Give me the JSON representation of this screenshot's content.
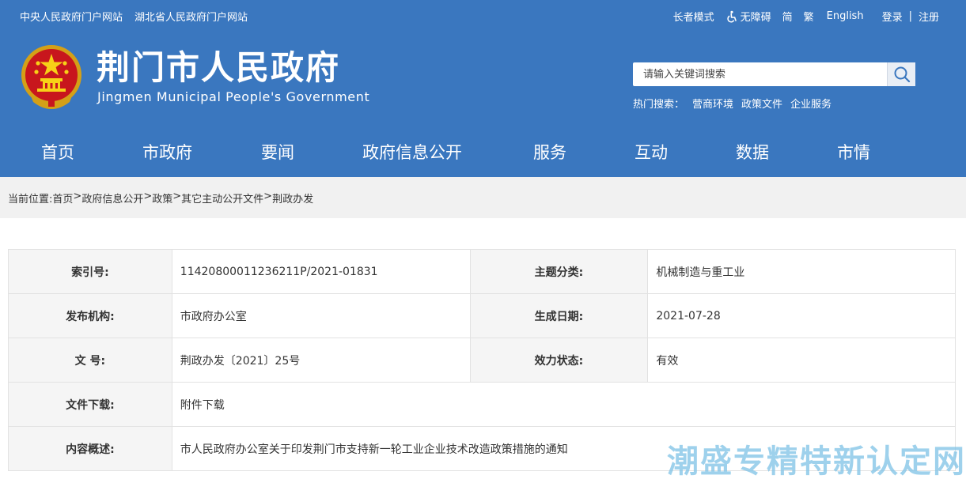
{
  "top_links": [
    "中央人民政府门户网站",
    "湖北省人民政府门户网站"
  ],
  "top_right": {
    "elder_mode": "长者模式",
    "accessibility": "无障碍",
    "simplified": "简",
    "traditional": "繁",
    "english": "English",
    "login": "登录",
    "separator": "|",
    "register": "注册"
  },
  "header": {
    "title": "荆门市人民政府",
    "subtitle": "Jingmen Municipal People's Government"
  },
  "search": {
    "placeholder": "请输入关键词搜索",
    "hot_label": "热门搜索：",
    "hot_items": [
      "营商环境",
      "政策文件",
      "企业服务"
    ]
  },
  "nav": [
    "首页",
    "市政府",
    "要闻",
    "政府信息公开",
    "服务",
    "互动",
    "数据",
    "市情"
  ],
  "breadcrumb": {
    "prefix": "当前位置:",
    "items": [
      "首页",
      "政府信息公开",
      "政策",
      "其它主动公开文件",
      "荆政办发"
    ],
    "sep": ">"
  },
  "meta": {
    "index_label": "索引号:",
    "index_value": "11420800011236211P/2021-01831",
    "topic_label": "主题分类:",
    "topic_value": "机械制造与重工业",
    "publisher_label": "发布机构:",
    "publisher_value": "市政府办公室",
    "date_label": "生成日期:",
    "date_value": "2021-07-28",
    "docno_label": "文 号:",
    "docno_value": "荆政办发〔2021〕25号",
    "status_label": "效力状态:",
    "status_value": "有效",
    "download_label": "文件下载:",
    "download_value": "附件下载",
    "summary_label": "内容概述:",
    "summary_value": "市人民政府办公室关于印发荆门市支持新一轮工业企业技术改造政策措施的通知"
  },
  "watermark": "潮盛专精特新认定网",
  "colors": {
    "header_bg": "#3a77bf",
    "crumb_bg": "#f1f1f1",
    "label_bg": "#f5f5f5"
  }
}
